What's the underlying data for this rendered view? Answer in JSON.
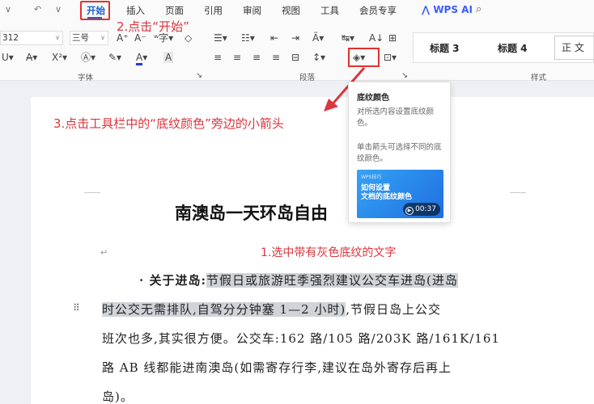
{
  "menubar": {
    "tabs": [
      "开始",
      "插入",
      "页面",
      "引用",
      "审阅",
      "视图",
      "工具",
      "会员专享"
    ],
    "active_tab": "开始",
    "wps_ai": "WPS AI",
    "icons": [
      "chevron-down-icon",
      "undo-icon",
      "search-icon"
    ]
  },
  "ribbon": {
    "font_size_value": "312",
    "paragraph_size_value": "三号",
    "font_group_label": "字体",
    "paragraph_group_label": "段落",
    "styles_group_label": "样式",
    "styles": [
      "标题 3",
      "标题 4",
      "正 文"
    ],
    "colors": {
      "font_color": "#1f3fd0",
      "highlight": "#e0322b"
    }
  },
  "annotations": {
    "step2": "2.点击“开始”",
    "step3": "3.点击工具栏中的“底纹颜色”旁边的小箭头",
    "step1": "1.选中带有灰色底纹的文字"
  },
  "tooltip": {
    "title": "底纹颜色",
    "desc1": "对所选内容设置底纹颜色。",
    "desc2": "单击箭头可选择不同的底纹颜色。",
    "video_small": "WPS技巧",
    "video_line1": "如何设置",
    "video_line2": "文档的底纹颜色",
    "video_duration": "00:37"
  },
  "document": {
    "title": "南澳岛一天环岛自由",
    "line1_prefix": "· 关于进岛:",
    "line1_hl": "节假日或旅游旺季强烈建议公交车进岛(进岛",
    "line2_hl": "时公交无需排队,自驾分分钟塞 1—2 小时)",
    "line2_rest": ",节假日岛上公交",
    "line3": "班次也多,其实很方便。公交车:162 路/105 路/203K 路/161K/161",
    "line4": "路 AB 线都能进南澳岛(如需寄存行李,建议在岛外寄存后再上",
    "line5": "岛)。"
  }
}
